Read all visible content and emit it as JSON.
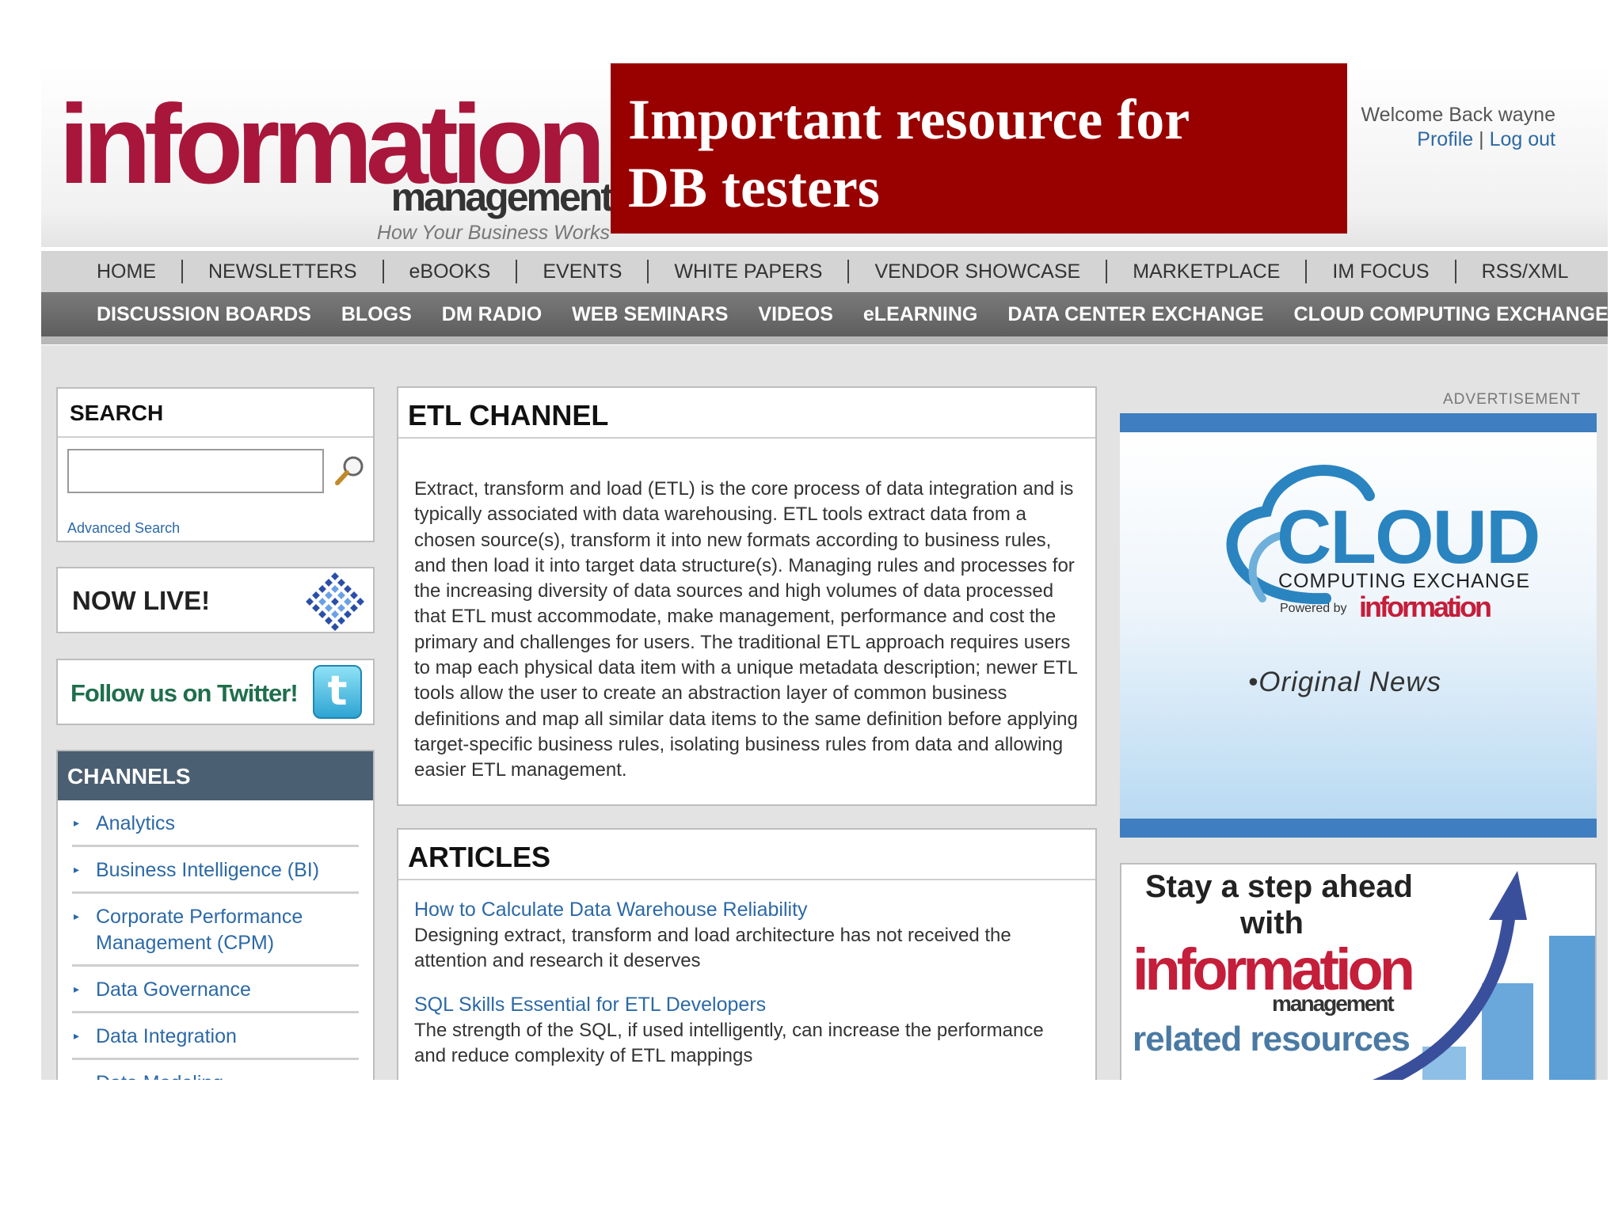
{
  "header": {
    "logo_main": "information",
    "logo_sub": "management",
    "logo_tagline": "How Your Business Works",
    "banner_line1": "Important resource for",
    "banner_line2": "DB testers",
    "welcome_text": "Welcome Back wayne",
    "profile_link": "Profile",
    "link_separator": "|",
    "logout_link": "Log out"
  },
  "nav_primary": [
    "HOME",
    "NEWSLETTERS",
    "eBOOKS",
    "EVENTS",
    "WHITE PAPERS",
    "VENDOR SHOWCASE",
    "MARKETPLACE",
    "IM FOCUS",
    "RSS/XML"
  ],
  "nav_secondary": [
    "DISCUSSION BOARDS",
    "BLOGS",
    "DM RADIO",
    "WEB SEMINARS",
    "VIDEOS",
    "eLEARNING",
    "DATA CENTER EXCHANGE",
    "CLOUD COMPUTING EXCHANGE"
  ],
  "sidebar": {
    "search_title": "SEARCH",
    "search_value": "",
    "advanced_search": "Advanced Search",
    "now_live": "NOW LIVE!",
    "twitter_label": "Follow us on Twitter!",
    "twitter_glyph": "t",
    "channels_title": "CHANNELS",
    "channels": [
      "Analytics",
      "Business Intelligence (BI)",
      "Corporate Performance Management (CPM)",
      "Data Governance",
      "Data Integration",
      "Data Modeling"
    ]
  },
  "etl": {
    "title": "ETL CHANNEL",
    "body": "Extract, transform and load (ETL) is the core process of data integration and is typically associated with data warehousing. ETL tools extract data from a chosen source(s), transform it into new formats according to business rules, and then load it into target data structure(s). Managing rules and processes for the increasing diversity of data sources and high volumes of data processed that ETL must accommodate, make management, performance and cost the primary and challenges for users. The traditional ETL approach requires users to map each physical data item with a unique metadata description; newer ETL tools allow the user to create an abstraction layer of common business definitions and map all similar data items to the same definition before applying target-specific business rules, isolating business rules from data and allowing easier ETL management."
  },
  "articles": {
    "title": "ARTICLES",
    "items": [
      {
        "title": "How to Calculate Data Warehouse Reliability",
        "desc": "Designing extract, transform and load architecture has not received the attention and research it deserves"
      },
      {
        "title": "SQL Skills Essential for ETL Developers",
        "desc": "The strength of the SQL, if used intelligently, can increase the performance and reduce complexity of ETL mappings"
      }
    ]
  },
  "ads": {
    "label": "ADVERTISEMENT",
    "cloud_word": "CLOUD",
    "cloud_sub": "COMPUTING EXCHANGE",
    "cloud_powered": "Powered by",
    "cloud_logo": "information",
    "cloud_news": "•Original News",
    "ad2_line1": "Stay a step ahead",
    "ad2_line2": "with",
    "ad2_logo": "information",
    "ad2_logo_sub": "management",
    "ad2_related": "related resources"
  },
  "colors": {
    "brand_red": "#a8173b",
    "banner_red": "#990000",
    "link_blue": "#2c69a6",
    "channels_header": "#4b5f72",
    "ad_blue": "#3f7ec0"
  }
}
